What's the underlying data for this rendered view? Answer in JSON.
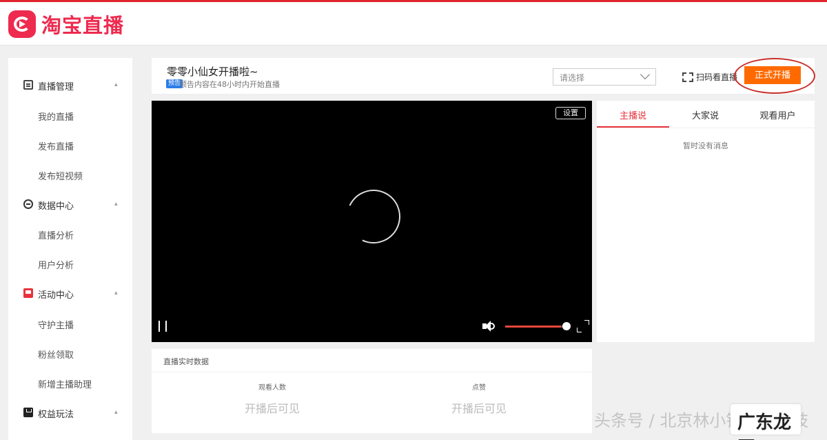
{
  "header": {
    "logo_text": "淘宝直播"
  },
  "sidebar": {
    "groups": [
      {
        "label": "直播管理",
        "icon": "document-icon",
        "items": [
          "我的直播",
          "发布直播",
          "发布短视频"
        ]
      },
      {
        "label": "数据中心",
        "icon": "circle-icon",
        "items": [
          "直播分析",
          "用户分析"
        ]
      },
      {
        "label": "活动中心",
        "icon": "activity-icon",
        "items": [
          "守护主播",
          "粉丝领取",
          "新增主播助理"
        ]
      },
      {
        "label": "权益玩法",
        "icon": "bag-icon",
        "items": []
      }
    ]
  },
  "title_bar": {
    "title": "零零小仙女开播啦~",
    "badge": "预告",
    "subtitle": "预告内容在48小时内开始直播",
    "select_value": "请选择",
    "scan_label": "扫码看直播",
    "start_label": "正式开播"
  },
  "video": {
    "settings_label": "设置",
    "volume_fraction": 0.9
  },
  "chat": {
    "tabs": [
      "主播说",
      "大家说",
      "观看用户"
    ],
    "active_tab": 0,
    "empty_text": "暂时没有消息"
  },
  "stats": {
    "title": "直播实时数据",
    "items": [
      {
        "label": "观看人数",
        "value": "开播后可见"
      },
      {
        "label": "点赞",
        "value": "开播后可见"
      }
    ]
  },
  "watermark": {
    "text": "头条号 / 北京林小铺网络科技",
    "badge": "广东龙网"
  }
}
